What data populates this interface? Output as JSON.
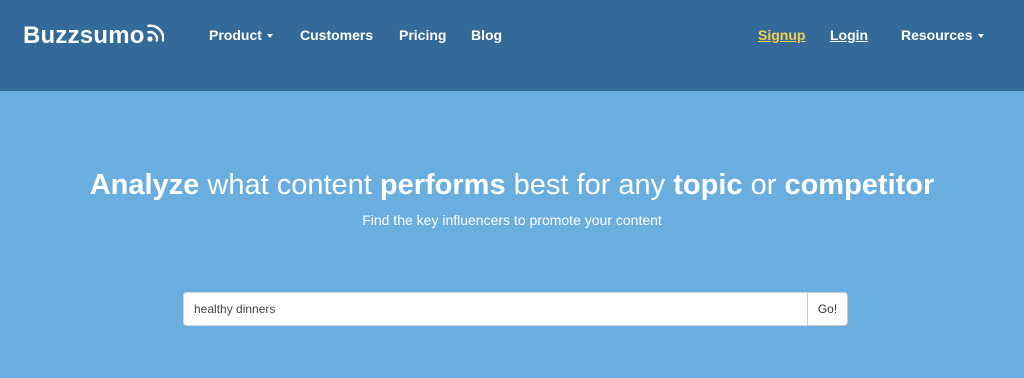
{
  "brand": {
    "name": "Buzzsumo",
    "logo_icon": "signal-waves-icon"
  },
  "nav": {
    "product": "Product",
    "customers": "Customers",
    "pricing": "Pricing",
    "blog": "Blog",
    "signup": "Signup",
    "login": "Login",
    "resources": "Resources"
  },
  "hero": {
    "title_parts": [
      "Analyze",
      " what content ",
      "performs",
      " best for any ",
      "topic",
      " or ",
      "competitor"
    ],
    "subtitle": "Find the key influencers to promote your content"
  },
  "search": {
    "value": "healthy dinners",
    "button_label": "Go!"
  },
  "colors": {
    "nav_bg": "#336a9a",
    "hero_bg": "#6aaee0",
    "signup_accent": "#f2d04b"
  }
}
